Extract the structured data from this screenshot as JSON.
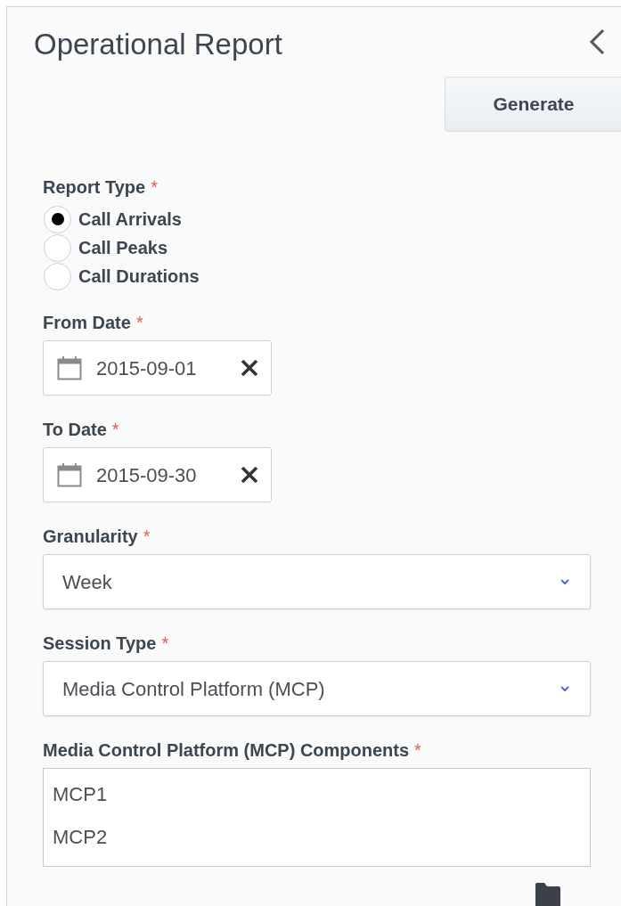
{
  "title": "Operational Report",
  "generate_button": "Generate",
  "fields": [
    {
      "kind": "radio",
      "label": "Report Type",
      "required_mark": "*",
      "options": [
        {
          "label": "Call Arrivals",
          "selected": true
        },
        {
          "label": "Call Peaks",
          "selected": false
        },
        {
          "label": "Call Durations",
          "selected": false
        }
      ]
    },
    {
      "kind": "date",
      "label": "From Date",
      "required_mark": "*",
      "value": "2015-09-01"
    },
    {
      "kind": "date",
      "label": "To Date",
      "required_mark": "*",
      "value": "2015-09-30"
    },
    {
      "kind": "select",
      "label": "Granularity",
      "required_mark": "*",
      "value": "Week"
    },
    {
      "kind": "select",
      "label": "Session Type",
      "required_mark": "*",
      "value": "Media Control Platform (MCP)"
    },
    {
      "kind": "list",
      "label": "Media Control Platform (MCP) Components",
      "required_mark": "*",
      "items": [
        "MCP1",
        "MCP2"
      ]
    }
  ]
}
